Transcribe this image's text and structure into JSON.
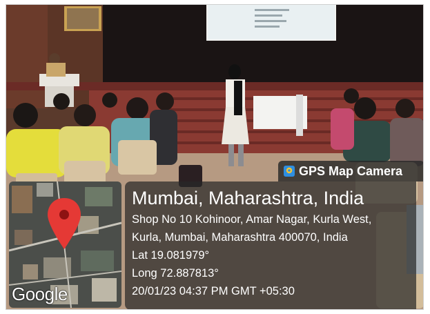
{
  "overlay": {
    "badge_title": "GPS Map Camera",
    "city": "Mumbai, Maharashtra, India",
    "address_line1": "Shop No 10 Kohinoor, Amar Nagar, Kurla West,",
    "address_line2": "Kurla, Mumbai, Maharashtra 400070, India",
    "latitude": "Lat 19.081979°",
    "longitude": "Long 72.887813°",
    "timestamp": "20/01/23 04:37 PM GMT +05:30",
    "map_attribution": "Google",
    "icons": {
      "badge": "gps-camera-icon",
      "pin": "map-pin-icon"
    },
    "colors": {
      "pin": "#e53935",
      "panel": "#2b2b2b"
    }
  }
}
